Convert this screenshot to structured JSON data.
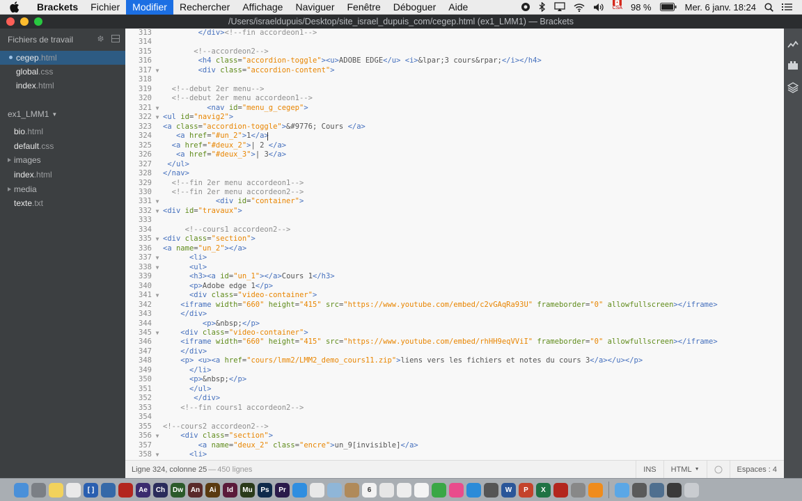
{
  "menubar": {
    "app": "Brackets",
    "items": [
      "Fichier",
      "Modifier",
      "Rechercher",
      "Affichage",
      "Naviguer",
      "Fenêtre",
      "Déboguer",
      "Aide"
    ],
    "active_index": 1,
    "battery": "98 %",
    "flag_label": "CSA",
    "clock": "Mer. 6 janv.  18:24"
  },
  "window": {
    "title": "/Users/israeldupuis/Desktop/site_israel_dupuis_com/cegep.html (ex1_LMM1) — Brackets"
  },
  "sidebar": {
    "working_files_title": "Fichiers de travail",
    "working_files": [
      {
        "name": "cegep",
        "ext": ".html",
        "selected": true
      },
      {
        "name": "global",
        "ext": ".css",
        "selected": false
      },
      {
        "name": "index",
        "ext": ".html",
        "selected": false
      }
    ],
    "project_name": "ex1_LMM1",
    "tree": [
      {
        "name": "bio",
        "ext": ".html",
        "folder": false
      },
      {
        "name": "default",
        "ext": ".css",
        "folder": false
      },
      {
        "name": "images",
        "ext": "",
        "folder": true
      },
      {
        "name": "index",
        "ext": ".html",
        "folder": false
      },
      {
        "name": "media",
        "ext": "",
        "folder": true
      },
      {
        "name": "texte",
        "ext": ".txt",
        "folder": false
      }
    ]
  },
  "editor": {
    "lines": [
      {
        "n": "313",
        "f": "",
        "t": "        </div><!--fin accordeon1-->"
      },
      {
        "n": "314",
        "f": "",
        "t": ""
      },
      {
        "n": "315",
        "f": "",
        "t": "       <!--accordeon2-->"
      },
      {
        "n": "316",
        "f": "",
        "t": "        <h4 class=\"accordion-toggle\"><u>ADOBE EDGE</u> <i>&lpar;3 cours&rpar;</i></h4>"
      },
      {
        "n": "317",
        "f": "▼",
        "t": "        <div class=\"accordion-content\">"
      },
      {
        "n": "318",
        "f": "",
        "t": ""
      },
      {
        "n": "319",
        "f": "",
        "t": "  <!--debut 2er menu-->"
      },
      {
        "n": "320",
        "f": "",
        "t": "  <!--debut 2er menu accordeon1-->"
      },
      {
        "n": "321",
        "f": "▼",
        "t": "          <nav id=\"menu_g_cegep\">"
      },
      {
        "n": "322",
        "f": "▼",
        "t": "<ul id=\"navig2\">"
      },
      {
        "n": "323",
        "f": "",
        "t": "<a class=\"accordion-toggle\">&#9776; Cours </a>"
      },
      {
        "n": "324",
        "f": "",
        "t": "   <a href=\"#un_2\">1</a>"
      },
      {
        "n": "325",
        "f": "",
        "t": "  <a href=\"#deux_2\">| 2 </a>"
      },
      {
        "n": "326",
        "f": "",
        "t": "   <a href=\"#deux_3\">| 3</a>"
      },
      {
        "n": "327",
        "f": "",
        "t": " </ul>"
      },
      {
        "n": "328",
        "f": "",
        "t": "</nav>"
      },
      {
        "n": "329",
        "f": "",
        "t": "  <!--fin 2er menu accordeon1-->"
      },
      {
        "n": "330",
        "f": "",
        "t": "  <!--fin 2er menu accordeon2-->"
      },
      {
        "n": "331",
        "f": "▼",
        "t": "            <div id=\"container\">"
      },
      {
        "n": "332",
        "f": "▼",
        "t": "<div id=\"travaux\">"
      },
      {
        "n": "333",
        "f": "",
        "t": ""
      },
      {
        "n": "334",
        "f": "",
        "t": "     <!--cours1 accordeon2-->"
      },
      {
        "n": "335",
        "f": "▼",
        "t": "<div class=\"section\">"
      },
      {
        "n": "336",
        "f": "",
        "t": "<a name=\"un_2\"></a>"
      },
      {
        "n": "337",
        "f": "▼",
        "t": "      <li>"
      },
      {
        "n": "338",
        "f": "▼",
        "t": "      <ul>"
      },
      {
        "n": "339",
        "f": "",
        "t": "      <h3><a id=\"un_1\"></a>Cours 1</h3>"
      },
      {
        "n": "340",
        "f": "",
        "t": "      <p>Adobe edge 1</p>"
      },
      {
        "n": "341",
        "f": "▼",
        "t": "      <div class=\"video-container\">"
      },
      {
        "n": "342",
        "f": "",
        "t": "    <iframe width=\"660\" height=\"415\" src=\"https://www.youtube.com/embed/c2vGAqRa93U\" frameborder=\"0\" allowfullscreen></iframe>"
      },
      {
        "n": "343",
        "f": "",
        "t": "    </div>"
      },
      {
        "n": "344",
        "f": "",
        "t": "         <p>&nbsp;</p>"
      },
      {
        "n": "345",
        "f": "▼",
        "t": "    <div class=\"video-container\">"
      },
      {
        "n": "346",
        "f": "",
        "t": "    <iframe width=\"660\" height=\"415\" src=\"https://www.youtube.com/embed/rhHH9eqVViI\" frameborder=\"0\" allowfullscreen></iframe>"
      },
      {
        "n": "347",
        "f": "",
        "t": "    </div>"
      },
      {
        "n": "348",
        "f": "",
        "t": "    <p> <u><a href=\"cours/lmm2/LMM2_demo_cours11.zip\">liens vers les fichiers et notes du cours 3</a></u></p>"
      },
      {
        "n": "349",
        "f": "",
        "t": "      </li>"
      },
      {
        "n": "350",
        "f": "",
        "t": "      <p>&nbsp;</p>"
      },
      {
        "n": "351",
        "f": "",
        "t": "      </ul>"
      },
      {
        "n": "352",
        "f": "",
        "t": "       </div>"
      },
      {
        "n": "353",
        "f": "",
        "t": "    <!--fin cours1 accordeon2-->"
      },
      {
        "n": "354",
        "f": "",
        "t": ""
      },
      {
        "n": "355",
        "f": "",
        "t": "<!--cours2 accordeon2-->"
      },
      {
        "n": "356",
        "f": "▼",
        "t": "    <div class=\"section\">"
      },
      {
        "n": "357",
        "f": "",
        "t": "        <a name=\"deux_2\" class=\"encre\">un_9[invisible]</a>"
      },
      {
        "n": "358",
        "f": "▼",
        "t": "      <li>"
      }
    ]
  },
  "statusbar": {
    "position": "Ligne 324, colonne 25",
    "sep": " — ",
    "line_count": "450 lignes",
    "mode": "INS",
    "language": "HTML",
    "indent": "Espaces : 4"
  },
  "dock": {
    "apps": [
      {
        "icon": "finder-icon",
        "label": "",
        "color": "#4a90d9"
      },
      {
        "icon": "system-preferences-icon",
        "label": "",
        "color": "#7b7f85"
      },
      {
        "icon": "notes-icon",
        "label": "",
        "color": "#f2d25c"
      },
      {
        "icon": "textedit-icon",
        "label": "",
        "color": "#e9e9e9"
      },
      {
        "icon": "brackets-icon",
        "label": "[ ]",
        "color": "#2a5fb0"
      },
      {
        "icon": "quicktime-icon",
        "label": "",
        "color": "#3569a8"
      },
      {
        "icon": "acrobat-icon",
        "label": "",
        "color": "#b3261e"
      },
      {
        "icon": "after-effects-icon",
        "label": "Ae",
        "color": "#3b2b6e"
      },
      {
        "icon": "character-animator-icon",
        "label": "Ch",
        "color": "#2a2c5b"
      },
      {
        "icon": "dreamweaver-icon",
        "label": "Dw",
        "color": "#2b5a2a"
      },
      {
        "icon": "animate-icon",
        "label": "An",
        "color": "#5a2a2a"
      },
      {
        "icon": "illustrator-icon",
        "label": "Ai",
        "color": "#5a3a10"
      },
      {
        "icon": "indesign-icon",
        "label": "Id",
        "color": "#5a1a3a"
      },
      {
        "icon": "muse-icon",
        "label": "Mu",
        "color": "#2a3a1a"
      },
      {
        "icon": "photoshop-icon",
        "label": "Ps",
        "color": "#0f2a4a"
      },
      {
        "icon": "premiere-icon",
        "label": "Pr",
        "color": "#2a1a4a"
      },
      {
        "icon": "safari-icon",
        "label": "",
        "color": "#2f8ee0"
      },
      {
        "icon": "chrome-icon",
        "label": "",
        "color": "#e8e8e8"
      },
      {
        "icon": "preview-icon",
        "label": "",
        "color": "#8fb6d8"
      },
      {
        "icon": "contacts-icon",
        "label": "",
        "color": "#b08a5a"
      },
      {
        "icon": "calendar-icon",
        "label": "6",
        "color": "#f2f2f2"
      },
      {
        "icon": "stickies-icon",
        "label": "",
        "color": "#e6e6e6"
      },
      {
        "icon": "reminders-icon",
        "label": "",
        "color": "#ededed"
      },
      {
        "icon": "photos-icon",
        "label": "",
        "color": "#f4f4f4"
      },
      {
        "icon": "facetime-icon",
        "label": "",
        "color": "#3aa746"
      },
      {
        "icon": "itunes-icon",
        "label": "",
        "color": "#e94c8c"
      },
      {
        "icon": "app-store-icon",
        "label": "",
        "color": "#2a8bd8"
      },
      {
        "icon": "disk-utility-icon",
        "label": "",
        "color": "#555"
      },
      {
        "icon": "word-icon",
        "label": "W",
        "color": "#2a5699"
      },
      {
        "icon": "powerpoint-icon",
        "label": "P",
        "color": "#c4432b"
      },
      {
        "icon": "excel-icon",
        "label": "X",
        "color": "#1f7244"
      },
      {
        "icon": "flash-icon",
        "label": "",
        "color": "#b3261e"
      },
      {
        "icon": "automator-icon",
        "label": "",
        "color": "#888"
      },
      {
        "icon": "vlc-icon",
        "label": "",
        "color": "#f08c1c"
      }
    ],
    "right": [
      {
        "icon": "folder-icon",
        "label": "",
        "color": "#5ba7e6"
      },
      {
        "icon": "screenshot-icon",
        "label": "",
        "color": "#5a5a5a"
      },
      {
        "icon": "downloads-icon",
        "label": "",
        "color": "#4f6f8f"
      },
      {
        "icon": "window-icon",
        "label": "",
        "color": "#3a3a3a"
      },
      {
        "icon": "trash-icon",
        "label": "",
        "color": "#c9ccd0"
      }
    ]
  }
}
